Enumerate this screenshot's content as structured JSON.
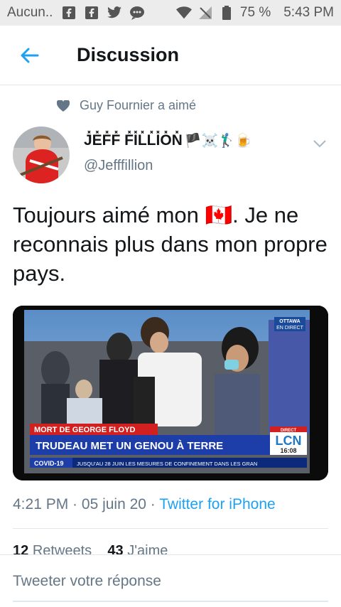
{
  "status_bar": {
    "carrier": "Aucun..",
    "battery": "75 %",
    "time": "5:43 PM",
    "icons": [
      "facebook-icon",
      "facebook-icon",
      "twitter-icon",
      "messenger-icon",
      "wifi-icon",
      "no-signal-icon",
      "battery-icon"
    ]
  },
  "header": {
    "title": "Discussion"
  },
  "liked_by": "Guy Fournier a aimé",
  "author": {
    "name": "J̽E̽F̽F̽ F̽I̽L̽L̽I̽O̽N̽",
    "name_emoji": "🏴☠️🏌🏼‍♂️🍺",
    "handle": "@Jefffillion"
  },
  "tweet": {
    "text_before_flag": "Toujours aimé mon ",
    "flag": "🇨🇦",
    "text_after_flag": ". Je ne reconnais plus dans mon propre pays."
  },
  "media": {
    "badge_city": "OTTAWA",
    "badge_live": "EN DIRECT",
    "headline_top": "MORT DE GEORGE FLOYD",
    "headline_main": "TRUDEAU MET UN GENOU À TERRE",
    "ticker_tag": "COVID-19",
    "ticker_text": "JUSQU'AU 28 JUIN LES MESURES DE CONFINEMENT DANS LES GRAN",
    "channel_direct": "DIRECT",
    "channel": "LCN",
    "clock": "16:08"
  },
  "meta": {
    "time": "4:21 PM",
    "date": "05 juin 20",
    "separator": " · ",
    "source": "Twitter for iPhone"
  },
  "stats": {
    "retweets_count": "12",
    "retweets_label": "Retweets",
    "likes_count": "43",
    "likes_label": "J'aime"
  },
  "reply": {
    "placeholder": "Tweeter votre réponse"
  },
  "colors": {
    "accent": "#1da1f2",
    "muted": "#657786",
    "text": "#14171a"
  }
}
